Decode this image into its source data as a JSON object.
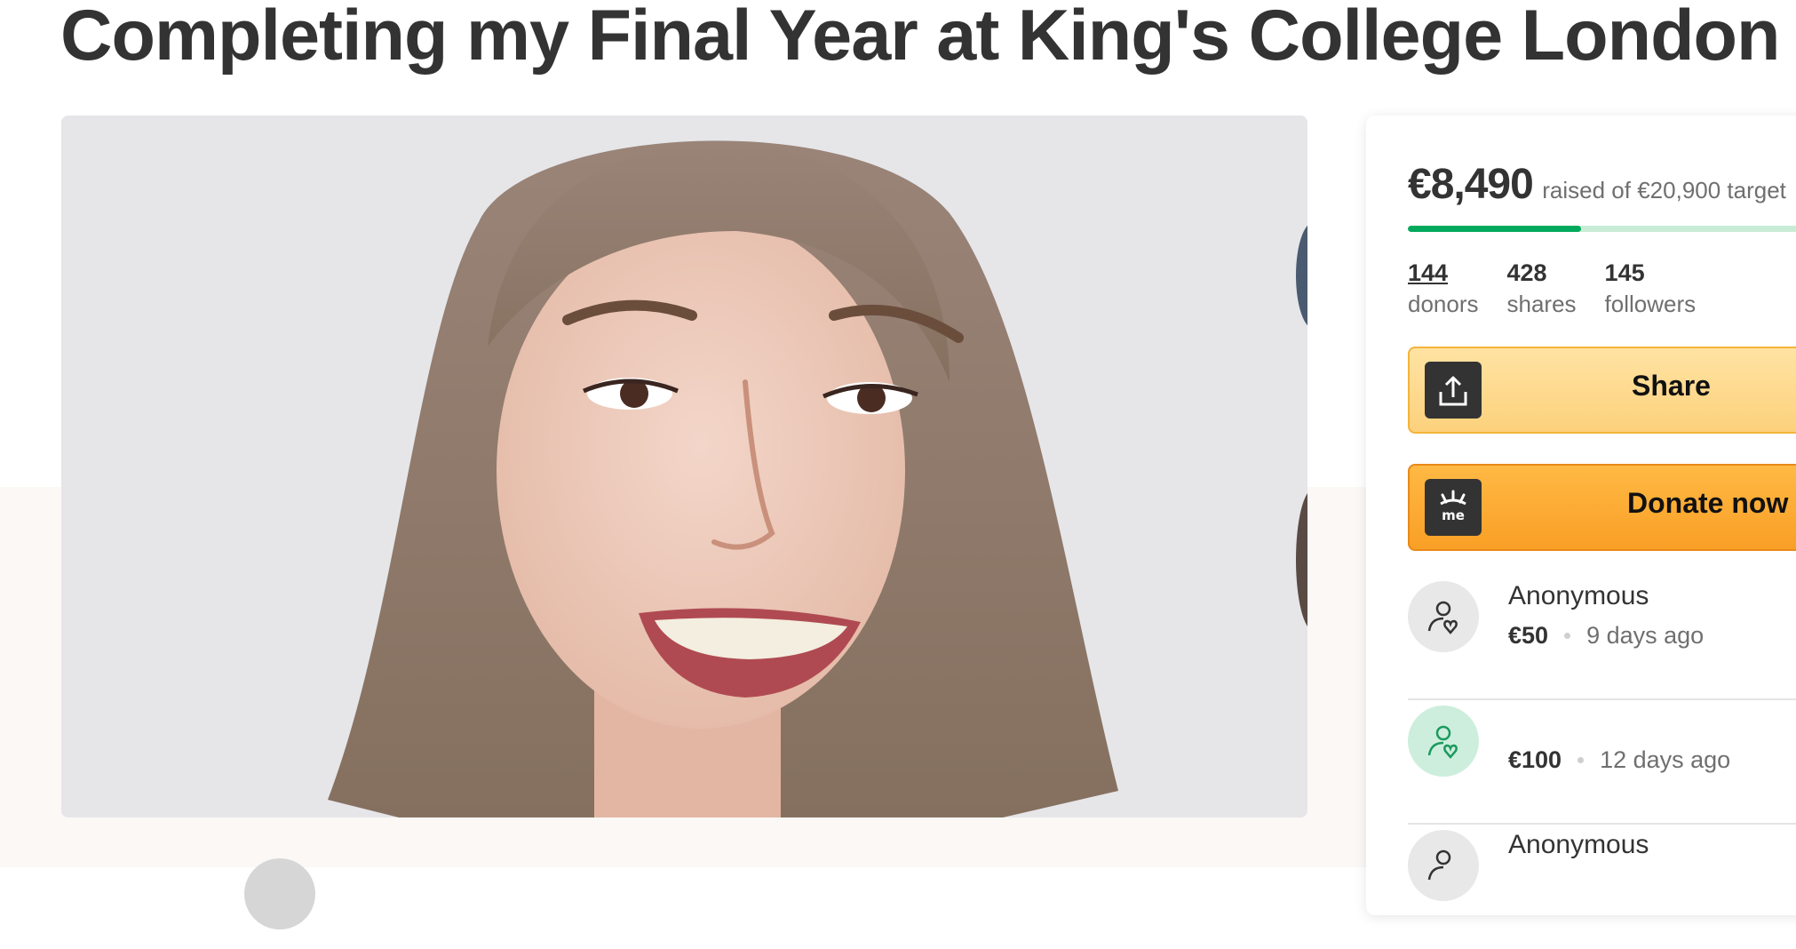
{
  "page": {
    "title": "Completing my Final Year at King's College London"
  },
  "fundraiser": {
    "raised_amount": "€8,490",
    "raised_of_text": "raised of €20,900 target",
    "progress_fraction": 0.406,
    "colors": {
      "progress": "#02a95c",
      "progress_track": "#c9ecd6",
      "share": "#fcd17c",
      "donate": "#f99f26"
    },
    "stats": [
      {
        "value": "144",
        "label": "donors"
      },
      {
        "value": "428",
        "label": "shares"
      },
      {
        "value": "145",
        "label": "followers"
      }
    ],
    "share_button": {
      "label": "Share",
      "icon": "share-icon"
    },
    "donate_button": {
      "label": "Donate now",
      "icon": "gofundme-icon"
    }
  },
  "donors": [
    {
      "name": "Anonymous",
      "amount": "€50",
      "time": "9 days ago",
      "avatar": "donor-heart-icon",
      "highlight": false
    },
    {
      "name": "",
      "amount": "€100",
      "time": "12 days ago",
      "avatar": "donor-heart-icon",
      "highlight": true
    },
    {
      "name": "Anonymous",
      "amount": "",
      "time": "",
      "avatar": "donor-heart-icon",
      "highlight": false
    }
  ]
}
